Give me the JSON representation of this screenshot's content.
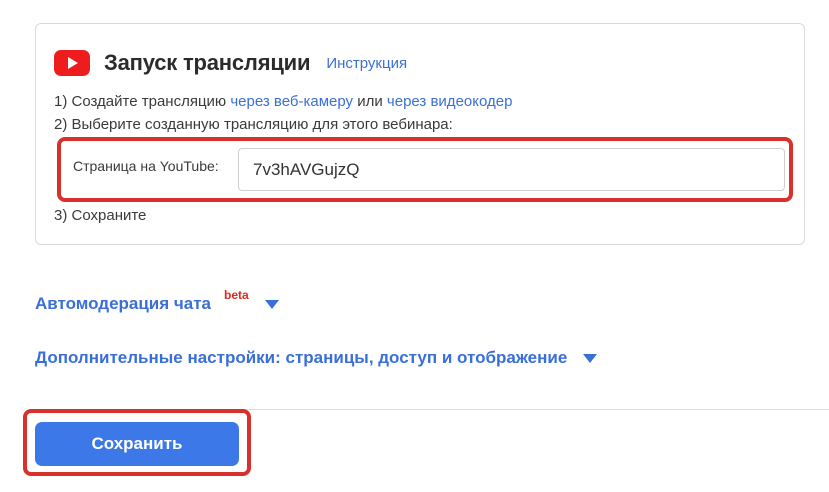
{
  "broadcast": {
    "title": "Запуск трансляции",
    "instruction_link": "Инструкция",
    "step1_prefix": "1) Создайте трансляцию ",
    "step1_link1": "через веб-камеру",
    "step1_mid": " или ",
    "step1_link2": "через видеокодер",
    "step2": "2) Выберите созданную трансляцию для этого вебинара:",
    "youtube_label": "Страница на YouTube:",
    "youtube_value": "7v3hAVGujzQ",
    "step3": "3) Сохраните"
  },
  "sections": {
    "chat_moderation": "Автомодерация чата",
    "beta_badge": "beta",
    "extra_settings": "Дополнительные настройки: страницы, доступ и отображение"
  },
  "footer": {
    "save_label": "Сохранить"
  },
  "colors": {
    "accent": "#3d78e8",
    "link": "#3a6fd8",
    "highlight": "#d8302b",
    "youtube": "#ee1c1c"
  },
  "icons": {
    "youtube": "youtube-icon",
    "chevron": "chevron-down-icon"
  }
}
